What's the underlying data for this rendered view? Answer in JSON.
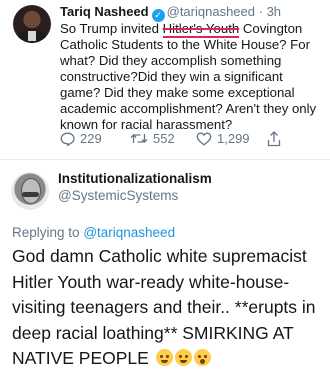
{
  "tweet": {
    "author_name": "Tariq Nasheed",
    "author_handle": "@tariqnasheed",
    "time": "· 3h",
    "text_before": "So Trump invited ",
    "text_struck": "Hitler's Youth",
    "text_after": " Covington Catholic Students to the White House? For what? Did they accomplish something constructive?Did they win a significant game? Did they make some exceptional academic accomplishment? Aren't they only known for racial harassment?",
    "replies": "229",
    "retweets": "552",
    "likes": "1,299"
  },
  "reply": {
    "author_name": "Institutionalizationalism",
    "author_handle": "@SystemicSystems",
    "replying_label": "Replying to",
    "replying_to": "@tariqnasheed",
    "text": "God damn Catholic white supremacist Hitler Youth war-ready white-house-visiting teenagers and their.. **erupts in deep racial loathing** SMIRKING AT NATIVE PEOPLE",
    "emojis": [
      "steaming-face-icon",
      "weary-face-icon",
      "astonished-face-icon"
    ]
  },
  "colors": {
    "link": "#1b95e0",
    "verified": "#1da1f2",
    "strike": "#e0245e",
    "muted": "#657786"
  }
}
